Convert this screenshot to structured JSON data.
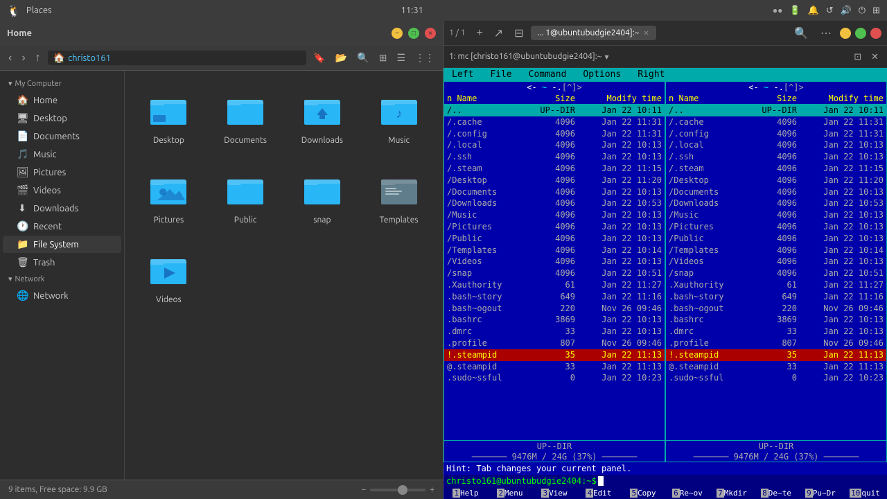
{
  "topbar": {
    "app_icon": "🐧",
    "places_label": "Places",
    "clock": "11:31",
    "indicators": [
      "●",
      "●",
      "🔋",
      "🔔",
      "↺",
      "🔊",
      "⏻",
      "⊞"
    ]
  },
  "filemanager": {
    "title": "Home",
    "breadcrumb_home": "christo161",
    "statusbar": {
      "items_text": "9 items, Free space: 9.9 GB"
    },
    "sidebar": {
      "my_computer_label": "My Computer",
      "items": [
        {
          "id": "home",
          "label": "Home",
          "icon": "🏠"
        },
        {
          "id": "desktop",
          "label": "Desktop",
          "icon": "🖥"
        },
        {
          "id": "documents",
          "label": "Documents",
          "icon": "📄"
        },
        {
          "id": "music",
          "label": "Music",
          "icon": "🎵"
        },
        {
          "id": "pictures",
          "label": "Pictures",
          "icon": "🖼"
        },
        {
          "id": "videos",
          "label": "Videos",
          "icon": "🎬"
        },
        {
          "id": "downloads",
          "label": "Downloads",
          "icon": "⬇"
        },
        {
          "id": "recent",
          "label": "Recent",
          "icon": "🕐"
        },
        {
          "id": "filesystem",
          "label": "File System",
          "icon": "📁"
        },
        {
          "id": "trash",
          "label": "Trash",
          "icon": "🗑"
        }
      ],
      "network_label": "Network",
      "network_items": [
        {
          "id": "network",
          "label": "Network",
          "icon": "🌐"
        }
      ]
    },
    "grid_items": [
      {
        "id": "desktop",
        "label": "Desktop",
        "color": "#4fc3f7"
      },
      {
        "id": "documents",
        "label": "Documents",
        "color": "#4fc3f7"
      },
      {
        "id": "downloads",
        "label": "Downloads",
        "color": "#4fc3f7"
      },
      {
        "id": "music",
        "label": "Music",
        "color": "#4fc3f7"
      },
      {
        "id": "pictures",
        "label": "Pictures",
        "color": "#4fc3f7"
      },
      {
        "id": "public",
        "label": "Public",
        "color": "#4fc3f7"
      },
      {
        "id": "snap",
        "label": "snap",
        "color": "#4fc3f7"
      },
      {
        "id": "templates",
        "label": "Templates",
        "color": "#b0bec5"
      },
      {
        "id": "videos",
        "label": "Videos",
        "color": "#4fc3f7"
      }
    ]
  },
  "terminal": {
    "tab_label": "1: mc [christo161@ubuntubudgie2404]:~",
    "title_bar_label": "... 1@ubuntubudgie2404]:~",
    "session_label": "1: mc [christo161@ubuntubudgie2404]:~",
    "tab_count_label": "1 / 1"
  },
  "mc": {
    "menus": [
      "Left",
      "File",
      "Command",
      "Options",
      "Right"
    ],
    "left_panel": {
      "path_top": "< ~ >",
      "path_bottom": ".[^]>",
      "col_headers": [
        "n  Name",
        "Size",
        "Modify time"
      ],
      "files": [
        {
          "name": "/..",
          "size": "UP--DIR",
          "date": "Jan 22 10:11",
          "selected": true
        },
        {
          "name": "/.cache",
          "size": "4096",
          "date": "Jan 22 11:31"
        },
        {
          "name": "/.config",
          "size": "4096",
          "date": "Jan 22 11:31"
        },
        {
          "name": "/.local",
          "size": "4096",
          "date": "Jan 22 10:13"
        },
        {
          "name": "/.ssh",
          "size": "4096",
          "date": "Jan 22 10:13"
        },
        {
          "name": "/.steam",
          "size": "4096",
          "date": "Jan 22 11:15"
        },
        {
          "name": "/Desktop",
          "size": "4096",
          "date": "Jan 22 11:20"
        },
        {
          "name": "/Documents",
          "size": "4096",
          "date": "Jan 22 10:13"
        },
        {
          "name": "/Downloads",
          "size": "4096",
          "date": "Jan 22 10:53"
        },
        {
          "name": "/Music",
          "size": "4096",
          "date": "Jan 22 10:13"
        },
        {
          "name": "/Pictures",
          "size": "4096",
          "date": "Jan 22 10:13"
        },
        {
          "name": "/Public",
          "size": "4096",
          "date": "Jan 22 10:13"
        },
        {
          "name": "/Templates",
          "size": "4096",
          "date": "Jan 22 10:14"
        },
        {
          "name": "/Videos",
          "size": "4096",
          "date": "Jan 22 10:13"
        },
        {
          "name": "/snap",
          "size": "4096",
          "date": "Jan 22 10:51"
        },
        {
          "name": ".Xauthority",
          "size": "61",
          "date": "Jan 22 11:27"
        },
        {
          "name": ".bash~story",
          "size": "649",
          "date": "Jan 22 11:16"
        },
        {
          "name": ".bash~ogout",
          "size": "220",
          "date": "Nov 26 09:46"
        },
        {
          "name": ".bashrc",
          "size": "3869",
          "date": "Jan 22 10:13"
        },
        {
          "name": ".dmrc",
          "size": "33",
          "date": "Jan 22 10:13"
        },
        {
          "name": ".profile",
          "size": "807",
          "date": "Nov 26 09:46"
        },
        {
          "name": "!.steampid",
          "size": "35",
          "date": "Jan 22 11:13",
          "highlighted": true
        },
        {
          "name": "@.steampid",
          "size": "33",
          "date": "Jan 22 11:13"
        },
        {
          "name": ".sudo~ssful",
          "size": "0",
          "date": "Jan 22 10:23"
        }
      ],
      "footer": "UP--DIR",
      "diskinfo": "9476M / 24G (37%)"
    },
    "right_panel": {
      "path_top": "< ~ >",
      "path_bottom": ".[^]>",
      "col_headers": [
        "n  Name",
        "Size",
        "Modify time"
      ],
      "files": [
        {
          "name": "/..",
          "size": "UP--DIR",
          "date": "Jan 22 10:11",
          "selected": true
        },
        {
          "name": "/.cache",
          "size": "4096",
          "date": "Jan 22 11:31"
        },
        {
          "name": "/.config",
          "size": "4096",
          "date": "Jan 22 11:31"
        },
        {
          "name": "/.local",
          "size": "4096",
          "date": "Jan 22 10:13"
        },
        {
          "name": "/.ssh",
          "size": "4096",
          "date": "Jan 22 10:13"
        },
        {
          "name": "/.steam",
          "size": "4096",
          "date": "Jan 22 11:15"
        },
        {
          "name": "/Desktop",
          "size": "4096",
          "date": "Jan 22 11:20"
        },
        {
          "name": "/Documents",
          "size": "4096",
          "date": "Jan 22 10:13"
        },
        {
          "name": "/Downloads",
          "size": "4096",
          "date": "Jan 22 10:53"
        },
        {
          "name": "/Music",
          "size": "4096",
          "date": "Jan 22 10:13"
        },
        {
          "name": "/Pictures",
          "size": "4096",
          "date": "Jan 22 10:13"
        },
        {
          "name": "/Public",
          "size": "4096",
          "date": "Jan 22 10:13"
        },
        {
          "name": "/Templates",
          "size": "4096",
          "date": "Jan 22 10:14"
        },
        {
          "name": "/Videos",
          "size": "4096",
          "date": "Jan 22 10:13"
        },
        {
          "name": "/snap",
          "size": "4096",
          "date": "Jan 22 10:51"
        },
        {
          "name": ".Xauthority",
          "size": "61",
          "date": "Jan 22 11:27"
        },
        {
          "name": ".bash~story",
          "size": "649",
          "date": "Jan 22 11:16"
        },
        {
          "name": ".bash~ogout",
          "size": "220",
          "date": "Nov 26 09:46"
        },
        {
          "name": ".bashrc",
          "size": "3869",
          "date": "Jan 22 10:13"
        },
        {
          "name": ".dmrc",
          "size": "33",
          "date": "Jan 22 10:13"
        },
        {
          "name": ".profile",
          "size": "807",
          "date": "Nov 26 09:46"
        },
        {
          "name": "!.steampid",
          "size": "35",
          "date": "Jan 22 11:13",
          "highlighted": true
        },
        {
          "name": "@.steampid",
          "size": "33",
          "date": "Jan 22 11:13"
        },
        {
          "name": ".sudo~ssful",
          "size": "0",
          "date": "Jan 22 10:23"
        }
      ],
      "footer": "UP--DIR",
      "diskinfo": "9476M / 24G (37%)"
    },
    "hint": "Hint: Tab changes your current panel.",
    "cmdline": "christo161@ubuntubudgie2404:~$",
    "funckeys": [
      {
        "num": "1",
        "label": "Help"
      },
      {
        "num": "2",
        "label": "Menu"
      },
      {
        "num": "3",
        "label": "View"
      },
      {
        "num": "4",
        "label": "Edit"
      },
      {
        "num": "5",
        "label": "Copy"
      },
      {
        "num": "6",
        "label": "Re~ov"
      },
      {
        "num": "7",
        "label": "Mkdir"
      },
      {
        "num": "8",
        "label": "De~te"
      },
      {
        "num": "9",
        "label": "Pu~Dr"
      },
      {
        "num": "10",
        "label": "quit"
      }
    ]
  },
  "colors": {
    "folder_blue": "#4fc3f7",
    "folder_dark": "#5a7a9a",
    "selected_bg": "#00aaaa",
    "highlighted_bg": "#aa0000",
    "highlighted_fg": "#ffff00",
    "mc_bg": "#0000aa",
    "mc_text": "#aaaaaa"
  }
}
